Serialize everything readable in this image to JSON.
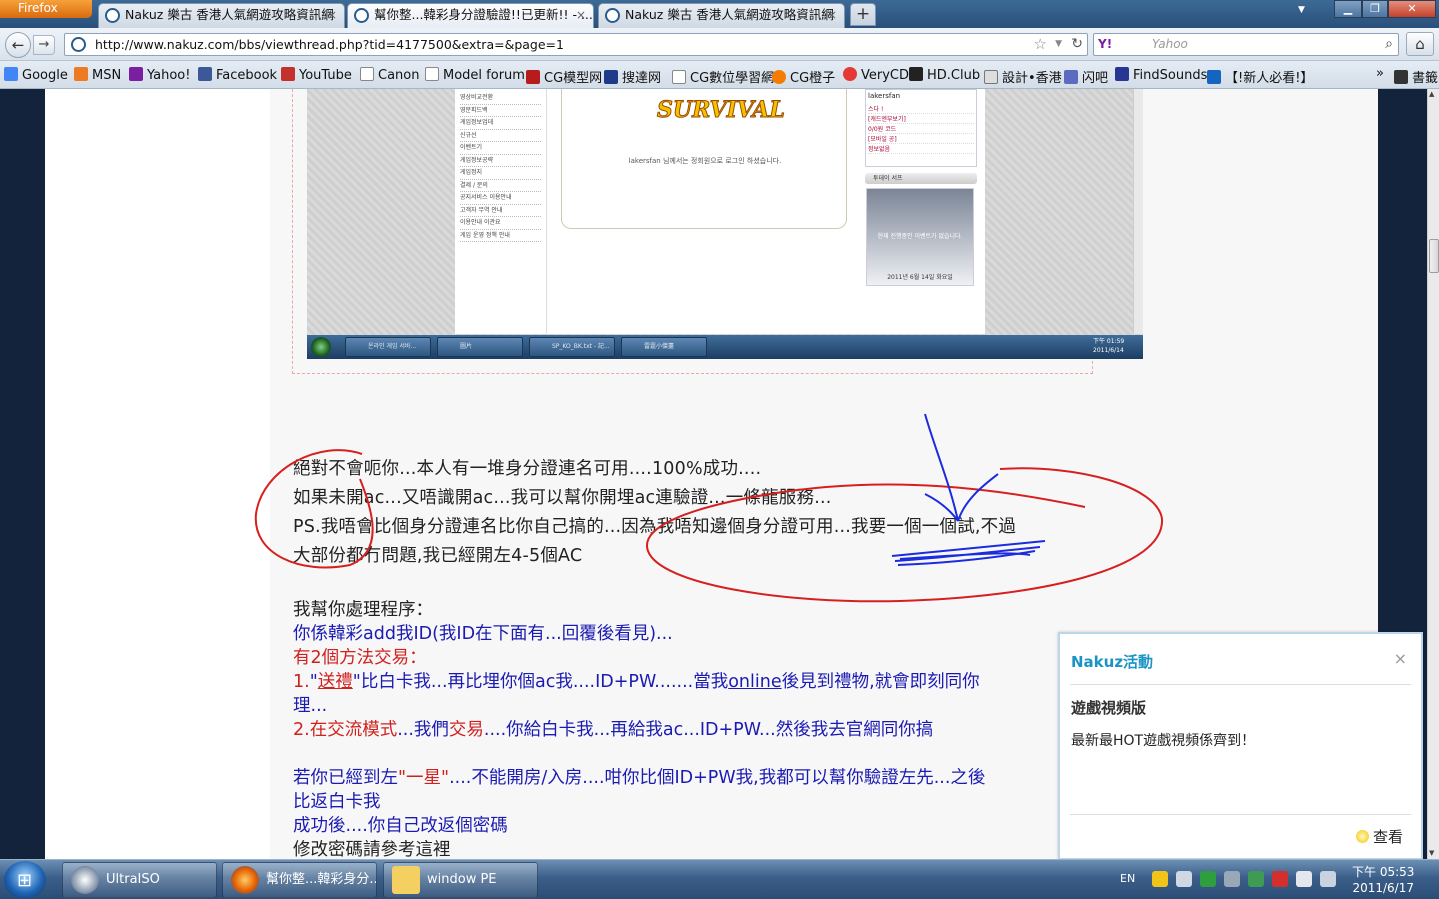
{
  "browser": {
    "menu_button": "Firefox",
    "tabs": [
      {
        "label": "Nakuz 樂古 香港人氣網遊攻略資訊網",
        "close": "×"
      },
      {
        "label": "幫你整...韓彩身分證驗證!!已更新!! - ...",
        "close": "×"
      },
      {
        "label": "Nakuz 樂古 香港人氣網遊攻略資訊網",
        "close": "×"
      }
    ],
    "new_tab": "+",
    "url": "http://www.nakuz.com/bbs/viewthread.php?tid=4177500&extra=&page=1",
    "search_placeholder": "Yahoo",
    "search_engine": "Y!",
    "bookmarks": [
      "Google",
      "MSN",
      "Yahoo!",
      "Facebook",
      "YouTube",
      "Canon",
      "Model forum",
      "CG模型网",
      "搜達网",
      "CG數位學習網",
      "CG橙子",
      "VeryCD",
      "HD.Club",
      "設計•香港",
      "闪吧",
      "FindSounds",
      "【!新人必看!】"
    ],
    "bookmarks_more": "»",
    "bookmarks_last": "書籤"
  },
  "embedded": {
    "menu": [
      "영상비교전환",
      "영문피드백",
      "게임정보업데",
      "신규선",
      "이벤트기",
      "게임정보공략",
      "게임정지",
      "결제 / 문의",
      "공지서비스 이용안내",
      "고객자 무역 안내",
      "이용안내 이관요",
      "게임 운영 정책 안내"
    ],
    "logo": "SURVIVAL",
    "note": "lakersfan 님께서는 정회원으로 로그인 하셨습니다.",
    "side_title": "lakersfan",
    "side_rows": [
      "스다 !",
      "[캐드엔부보기]",
      "0/0원 코드",
      "[모바일 공]",
      "정보없음"
    ],
    "bar": "투데이 서프",
    "ad": "현재 진행중인 이벤트가 없습니다.",
    "ad_date": "2011년 6월 14일 화요일",
    "taskbar": [
      "온라인 게임 서바...",
      "圖片",
      "SP_KO_BK.txt - 記...",
      "雷霆小傑盡"
    ],
    "clock": [
      "下午 01:59",
      "2011/6/14"
    ]
  },
  "post": {
    "lines1": [
      "絕對不會呃你...本人有一堆身分證連名可用....100%成功....",
      "如果未開ac...又唔識開ac...我可以幫你開埋ac連驗證...一條龍服務...",
      "PS.我唔會比個身分證連名比你自己搞的...因為我唔知邊個身分證可用...我要一個一個試,不過",
      "大部份都冇問題,我已經開左4-5個AC"
    ],
    "process_title": "我幫你處理程序：",
    "step_intro": "你係韓彩add我ID(我ID在下面有...回覆後看見)...",
    "methods_pre": "有",
    "methods_num": "2",
    "methods_post": "個方法交易：",
    "m1_num": "1.",
    "m1_q1": "\"",
    "m1_gift": "送禮",
    "m1_q2": "\"",
    "m1_text": "比白卡我...再比埋你個ac我....ID+PW.......當我",
    "m1_online": "online",
    "m1_text2": "後見到禮物,就會即刻同你",
    "m1_cont": "理...",
    "m2_num": "2.",
    "m2_mode": "在交流模式",
    "m2_text1": "...我們",
    "m2_trade": "交易",
    "m2_text2": "....你給白卡我...再給我ac...ID+PW...然後我去官網同你搞",
    "star_pre": "若你已經到左",
    "star_q": "\"一星\"",
    "star_post": "....不能開房/入房....咁你比個ID+PW我,我都可以幫你驗證左先...之後",
    "star_cont": "比返白卡我",
    "success": "成功後....你自己改返個密碼",
    "change_pw": "修改密碼請參考這裡"
  },
  "popup": {
    "title": "Nakuz活動",
    "close": "×",
    "heading": "遊戲視頻版",
    "body": "最新最HOT遊戲視頻係齊到！",
    "view": "查看"
  },
  "taskbar": {
    "items": [
      "UltraISO",
      "幫你整...韓彩身分...",
      "window PE"
    ],
    "lang": "EN",
    "time": "下午 05:53",
    "date": "2011/6/17"
  },
  "colors": {
    "accent_red": "#d0211f",
    "post_blue": "#1b1bb3",
    "annotation_red": "#d62020",
    "annotation_blue": "#1a2be0",
    "popup_title": "#1c93c6"
  }
}
